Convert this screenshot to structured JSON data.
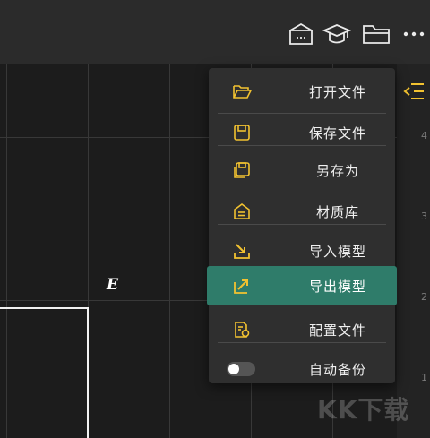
{
  "toolbar": {
    "icons": [
      "camera-box-icon",
      "graduation-cap-icon",
      "folder-icon",
      "more-icon"
    ]
  },
  "canvas": {
    "point_label": "E"
  },
  "side_panel": {
    "numbers": [
      "4",
      "3",
      "2",
      "1"
    ]
  },
  "menu": {
    "items": [
      {
        "label": "打开文件",
        "icon": "folder-open-icon"
      },
      {
        "label": "保存文件",
        "icon": "save-icon"
      },
      {
        "label": "另存为",
        "icon": "save-as-icon"
      },
      {
        "label": "材质库",
        "icon": "material-library-icon"
      },
      {
        "label": "导入模型",
        "icon": "import-icon"
      },
      {
        "label": "导出模型",
        "icon": "export-icon",
        "active": true
      },
      {
        "label": "配置文件",
        "icon": "config-file-icon"
      },
      {
        "label": "自动备份",
        "icon": "toggle-switch",
        "toggle_on": false
      }
    ],
    "accent_color": "#f2c230",
    "active_color": "#2f7c6a"
  },
  "watermark": {
    "text": "KK下载"
  }
}
